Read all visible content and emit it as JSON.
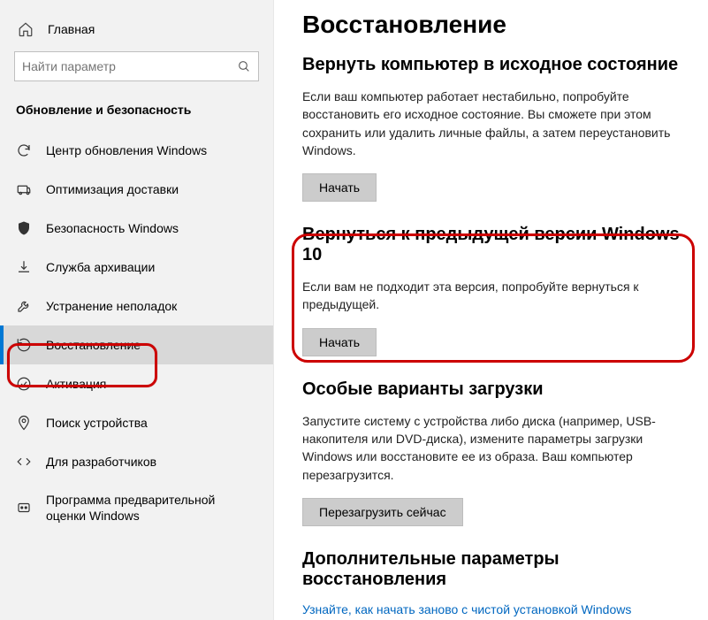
{
  "home_label": "Главная",
  "search_placeholder": "Найти параметр",
  "section_title": "Обновление и безопасность",
  "nav": [
    {
      "label": "Центр обновления Windows"
    },
    {
      "label": "Оптимизация доставки"
    },
    {
      "label": "Безопасность Windows"
    },
    {
      "label": "Служба архивации"
    },
    {
      "label": "Устранение неполадок"
    },
    {
      "label": "Восстановление"
    },
    {
      "label": "Активация"
    },
    {
      "label": "Поиск устройства"
    },
    {
      "label": "Для разработчиков"
    },
    {
      "label": "Программа предварительной оценки Windows"
    }
  ],
  "page_title": "Восстановление",
  "reset": {
    "title": "Вернуть компьютер в исходное состояние",
    "desc": "Если ваш компьютер работает нестабильно, попробуйте восстановить его исходное состояние. Вы сможете при этом сохранить или удалить личные файлы, а затем переустановить Windows.",
    "button": "Начать"
  },
  "goback": {
    "title": "Вернуться к предыдущей версии Windows 10",
    "desc": "Если вам не подходит эта версия, попробуйте вернуться к предыдущей.",
    "button": "Начать"
  },
  "advanced": {
    "title": "Особые варианты загрузки",
    "desc": "Запустите систему с устройства либо диска (например, USB-накопителя или DVD-диска), измените параметры загрузки Windows или восстановите ее из образа. Ваш компьютер перезагрузится.",
    "button": "Перезагрузить сейчас"
  },
  "more": {
    "title": "Дополнительные параметры восстановления",
    "link": "Узнайте, как начать заново с чистой установкой Windows"
  }
}
